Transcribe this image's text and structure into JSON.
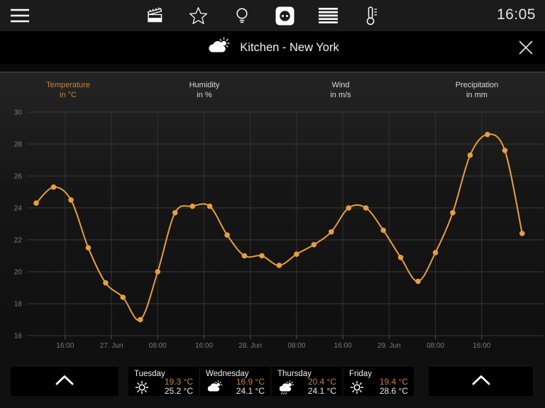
{
  "top_bar": {
    "time": "16:05",
    "icons": [
      "menu-icon",
      "scenes-icon",
      "star-icon",
      "bulb-icon",
      "socket-icon",
      "list-icon",
      "thermometer-icon"
    ]
  },
  "title_bar": {
    "icon": "partly-cloudy-icon",
    "title": "Kitchen - New York",
    "close_icon": "close-icon"
  },
  "tabs": [
    {
      "label": "Temperature",
      "unit": "in °C",
      "active": true
    },
    {
      "label": "Humidity",
      "unit": "in %",
      "active": false
    },
    {
      "label": "Wind",
      "unit": "in m/s",
      "active": false
    },
    {
      "label": "Precipitation",
      "unit": "in mm",
      "active": false
    }
  ],
  "chart_data": {
    "type": "line",
    "title": "Temperature in °C",
    "series": [
      {
        "name": "Temperature (°C)",
        "x_hours": [
          11,
          14,
          17,
          20,
          23,
          26,
          29,
          32,
          35,
          38,
          41,
          44,
          47,
          50,
          53,
          56,
          59,
          62,
          65,
          68,
          71,
          74,
          77,
          80,
          83,
          86,
          89,
          92,
          95
        ],
        "values": [
          24.3,
          25.3,
          24.5,
          21.5,
          19.3,
          18.4,
          17.0,
          20.0,
          23.7,
          24.1,
          24.1,
          22.3,
          21.0,
          21.0,
          20.4,
          21.1,
          21.7,
          22.5,
          24.0,
          24.0,
          22.6,
          20.9,
          19.4,
          21.2,
          23.7,
          27.3,
          28.6,
          27.6,
          22.4
        ]
      }
    ],
    "x_hours_origin": "26. Jun 00:00, points every 3 h",
    "x_gridlines": [
      {
        "hour": 16,
        "label": "16:00"
      },
      {
        "hour": 24,
        "label": "27. Jun"
      },
      {
        "hour": 32,
        "label": "08:00"
      },
      {
        "hour": 40,
        "label": "16:00"
      },
      {
        "hour": 48,
        "label": "28. Jun"
      },
      {
        "hour": 56,
        "label": "08:00"
      },
      {
        "hour": 64,
        "label": "16:00"
      },
      {
        "hour": 72,
        "label": "29. Jun"
      },
      {
        "hour": 80,
        "label": "08:00"
      },
      {
        "hour": 88,
        "label": "16:00"
      }
    ],
    "x_domain_hours": [
      9.4,
      98.7
    ],
    "ylim": [
      16,
      30
    ],
    "y_ticks": [
      16,
      18,
      20,
      22,
      24,
      26,
      28,
      30
    ],
    "grid": true,
    "legend": "none",
    "line_color": "#e89d3e",
    "grid_color": "#3a3a3a",
    "axis_text_color": "#7e7e7e"
  },
  "forecast": {
    "days": [
      {
        "name": "Tuesday",
        "icon": "sun-icon",
        "temp_min": "19.3 °C",
        "temp_max": "25.2 °C"
      },
      {
        "name": "Wednesday",
        "icon": "cloud-sun-icon",
        "temp_min": "16.9 °C",
        "temp_max": "24.1 °C"
      },
      {
        "name": "Thursday",
        "icon": "rain-sun-icon",
        "temp_min": "20.4 °C",
        "temp_max": "24.1 °C"
      },
      {
        "name": "Friday",
        "icon": "sun-icon",
        "temp_min": "19.4 °C",
        "temp_max": "28.6 °C"
      }
    ]
  },
  "colors": {
    "accent_orange": "#e89d3e",
    "tab_active_orange": "#c9842e",
    "temp_min_orange": "#cc8429",
    "topbar_bg": "#1b1b1b",
    "titlebar_bg": "#010101",
    "card_bg": "#000000"
  }
}
